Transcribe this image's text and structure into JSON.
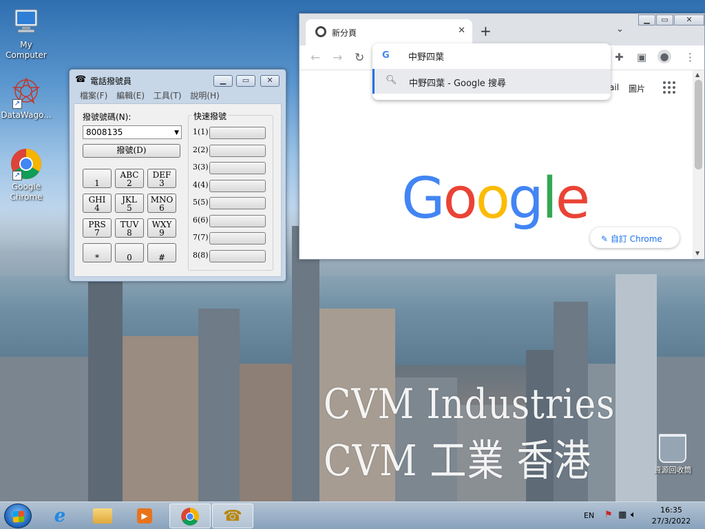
{
  "desktop": {
    "icons": [
      {
        "label": "My\nComputer"
      },
      {
        "label": "DataWago..."
      },
      {
        "label": "Google\nChrome"
      }
    ],
    "recycle_bin": "資源回收筒",
    "watermark_line1": "CVM Industries",
    "watermark_line2": "CVM 工業 香港"
  },
  "dialer": {
    "title": "電話撥號員",
    "menu": [
      "檔案(F)",
      "編輯(E)",
      "工具(T)",
      "說明(H)"
    ],
    "number_label": "撥號號碼(N):",
    "number_value": "8008135",
    "dial_button": "撥號(D)",
    "speed_dial_title": "快速撥號",
    "speed_dial_labels": [
      "1(1)",
      "2(2)",
      "3(3)",
      "4(4)",
      "5(5)",
      "6(6)",
      "7(7)",
      "8(8)"
    ],
    "keys": [
      {
        "top": "",
        "bottom": "1"
      },
      {
        "top": "ABC",
        "bottom": "2"
      },
      {
        "top": "DEF",
        "bottom": "3"
      },
      {
        "top": "GHI",
        "bottom": "4"
      },
      {
        "top": "JKL",
        "bottom": "5"
      },
      {
        "top": "MNO",
        "bottom": "6"
      },
      {
        "top": "PRS",
        "bottom": "7"
      },
      {
        "top": "TUV",
        "bottom": "8"
      },
      {
        "top": "WXY",
        "bottom": "9"
      },
      {
        "top": "",
        "bottom": "*"
      },
      {
        "top": "",
        "bottom": "0"
      },
      {
        "top": "",
        "bottom": "#"
      }
    ]
  },
  "chrome": {
    "tab_title": "新分頁",
    "omnibox_text": "中野四葉",
    "suggestion": "中野四葉 - Google 搜尋",
    "gmail_link": "ail",
    "images_link": "圖片",
    "customize_label": "自訂 Chrome",
    "logo_letters": [
      {
        "ch": "G",
        "color": "#4285f4"
      },
      {
        "ch": "o",
        "color": "#ea4335"
      },
      {
        "ch": "o",
        "color": "#fbbc05"
      },
      {
        "ch": "g",
        "color": "#4285f4"
      },
      {
        "ch": "l",
        "color": "#34a853"
      },
      {
        "ch": "e",
        "color": "#ea4335"
      }
    ]
  },
  "taskbar": {
    "language": "EN",
    "time": "16:35",
    "date": "27/3/2022"
  }
}
